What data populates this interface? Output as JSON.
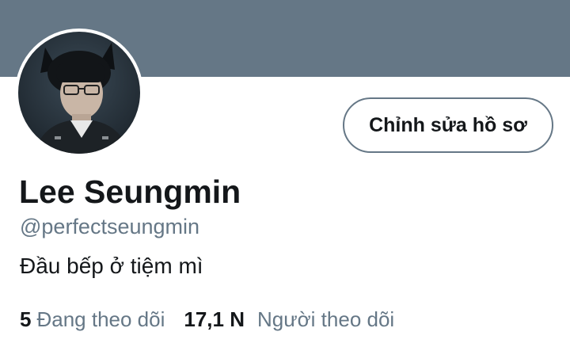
{
  "profile": {
    "display_name": "Lee Seungmin",
    "handle": "@perfectseungmin",
    "bio": "Đầu bếp ở tiệm mì",
    "edit_button_label": "Chỉnh sửa hồ sơ"
  },
  "stats": {
    "following_count": "5",
    "following_label": "Đang theo dõi",
    "followers_count": "17,1 N",
    "followers_label": "Người theo dõi"
  },
  "colors": {
    "banner": "#657786",
    "secondary_text": "#657786",
    "primary_text": "#14171a"
  }
}
